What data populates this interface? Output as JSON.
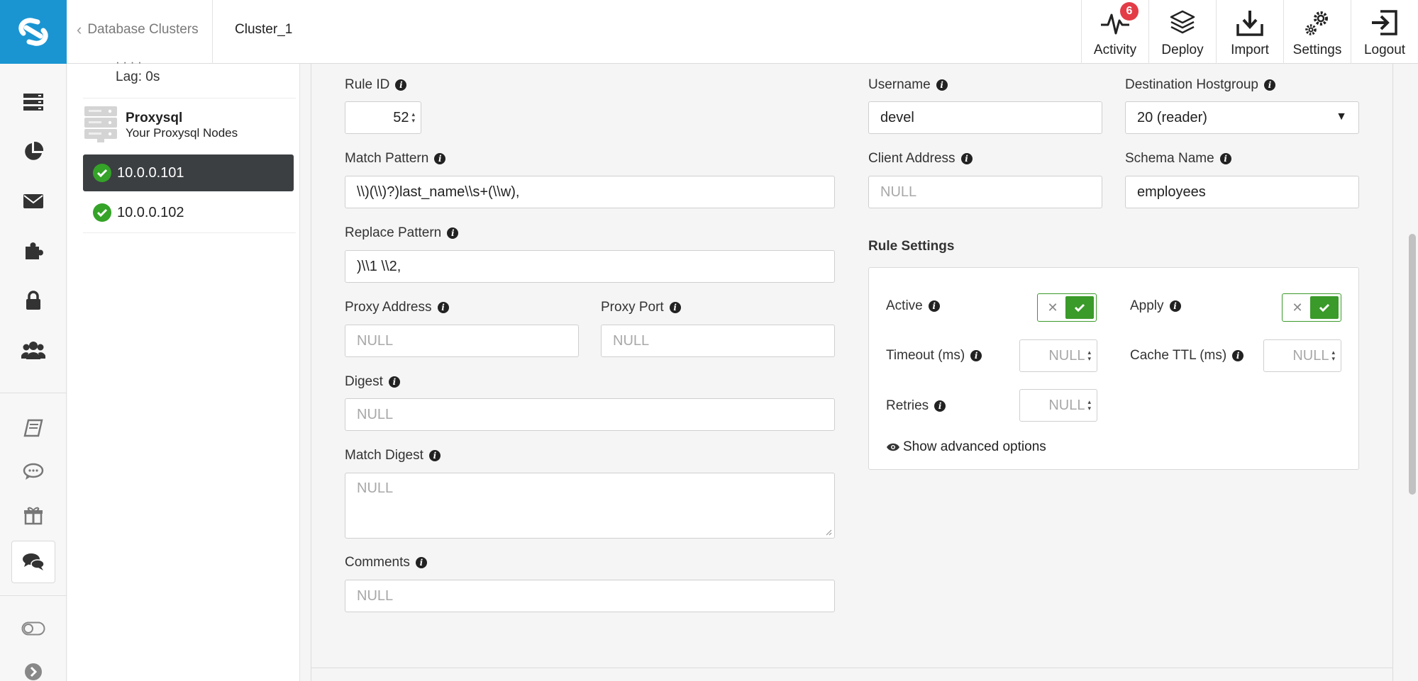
{
  "header": {
    "back_label": "Database Clusters",
    "cluster_name": "Cluster_1",
    "actions": [
      {
        "label": "Activity",
        "badge": "6"
      },
      {
        "label": "Deploy"
      },
      {
        "label": "Import"
      },
      {
        "label": "Settings"
      },
      {
        "label": "Logout"
      }
    ]
  },
  "nodes": {
    "lag_text": "Lag: 0s",
    "proxysql_title": "Proxysql",
    "proxysql_subtitle": "Your Proxysql Nodes",
    "items": [
      {
        "label": "10.0.0.101",
        "active": true
      },
      {
        "label": "10.0.0.102",
        "active": false
      }
    ]
  },
  "form": {
    "rule_id": {
      "label": "Rule ID",
      "value": "52"
    },
    "match_pattern": {
      "label": "Match Pattern",
      "value": "\\\\)(\\\\)?)last_name\\\\s+(\\\\w),"
    },
    "replace_pattern": {
      "label": "Replace Pattern",
      "value": ")\\\\1 \\\\2,"
    },
    "proxy_address": {
      "label": "Proxy Address",
      "placeholder": "NULL"
    },
    "proxy_port": {
      "label": "Proxy Port",
      "placeholder": "NULL"
    },
    "digest": {
      "label": "Digest",
      "placeholder": "NULL"
    },
    "match_digest": {
      "label": "Match Digest",
      "placeholder": "NULL"
    },
    "comments": {
      "label": "Comments",
      "placeholder": "NULL"
    },
    "username": {
      "label": "Username",
      "value": "devel"
    },
    "destination_hostgroup": {
      "label": "Destination Hostgroup",
      "value": "20 (reader)"
    },
    "client_address": {
      "label": "Client Address",
      "placeholder": "NULL"
    },
    "schema_name": {
      "label": "Schema Name",
      "value": "employees"
    }
  },
  "rule_settings": {
    "title": "Rule Settings",
    "active": {
      "label": "Active",
      "on": true
    },
    "apply": {
      "label": "Apply",
      "on": true
    },
    "timeout": {
      "label": "Timeout (ms)",
      "placeholder": "NULL"
    },
    "cache_ttl": {
      "label": "Cache TTL (ms)",
      "placeholder": "NULL"
    },
    "retries": {
      "label": "Retries",
      "placeholder": "NULL"
    },
    "advanced_link": "Show advanced options"
  },
  "colors": {
    "brand": "#1a95d2",
    "success": "#34a328",
    "badge": "#e33c47",
    "active_node_bg": "#3b3f42"
  }
}
